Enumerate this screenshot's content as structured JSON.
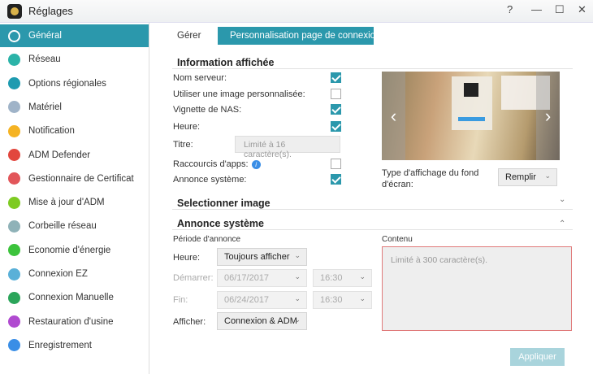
{
  "window": {
    "title": "Réglages",
    "help": "?",
    "minimize": "—",
    "maximize": "☐",
    "close": "✕"
  },
  "sidebar": {
    "items": [
      {
        "label": "Général",
        "color": "#ffffff"
      },
      {
        "label": "Réseau",
        "color": "#2bb3a8"
      },
      {
        "label": "Options régionales",
        "color": "#1e9bb0"
      },
      {
        "label": "Matériel",
        "color": "#9fb3c8"
      },
      {
        "label": "Notification",
        "color": "#f5b323"
      },
      {
        "label": "ADM Defender",
        "color": "#e2463d"
      },
      {
        "label": "Gestionnaire de Certificat",
        "color": "#e2565a"
      },
      {
        "label": "Mise à jour d'ADM",
        "color": "#7ecb22"
      },
      {
        "label": "Corbeille réseau",
        "color": "#8fb2b8"
      },
      {
        "label": "Economie d'énergie",
        "color": "#3cc33c"
      },
      {
        "label": "Connexion EZ",
        "color": "#5ab0d8"
      },
      {
        "label": "Connexion Manuelle",
        "color": "#2ba55a"
      },
      {
        "label": "Restauration d'usine",
        "color": "#b04ad0"
      },
      {
        "label": "Enregistrement",
        "color": "#3a8ee6"
      }
    ]
  },
  "tabs": [
    {
      "label": "Gérer"
    },
    {
      "label": "Personnalisation page de connexion"
    }
  ],
  "info": {
    "title": "Information affichée",
    "rows": [
      {
        "label": "Nom serveur:",
        "checked": true
      },
      {
        "label": "Utiliser une image personnalisée:",
        "checked": false
      },
      {
        "label": "Vignette de NAS:",
        "checked": true
      },
      {
        "label": "Heure:",
        "checked": true
      }
    ],
    "title_label": "Titre:",
    "title_placeholder": "Limité à 16 caractère(s).",
    "shortcuts_label": "Raccourcis d'apps:",
    "shortcuts_checked": false,
    "info_icon": "i",
    "announce_label": "Annonce système:",
    "announce_checked": true
  },
  "preview": {
    "prev": "‹",
    "next": "›",
    "display_label": "Type d'affichage du fond d'écran:",
    "display_value": "Remplir"
  },
  "select_image": {
    "title": "Selectionner image",
    "toggle": "⌄"
  },
  "announce": {
    "title": "Annonce système",
    "toggle": "⌃",
    "period_label": "Période d'annonce",
    "hour_label": "Heure:",
    "hour_value": "Toujours afficher",
    "start_label": "Démarrer:",
    "start_date": "06/17/2017",
    "start_time": "16:30",
    "end_label": "Fin:",
    "end_date": "06/24/2017",
    "end_time": "16:30",
    "show_label": "Afficher:",
    "show_value": "Connexion & ADM",
    "content_label": "Contenu",
    "content_placeholder": "Limité à 300 caractère(s)."
  },
  "apply_label": "Appliquer"
}
